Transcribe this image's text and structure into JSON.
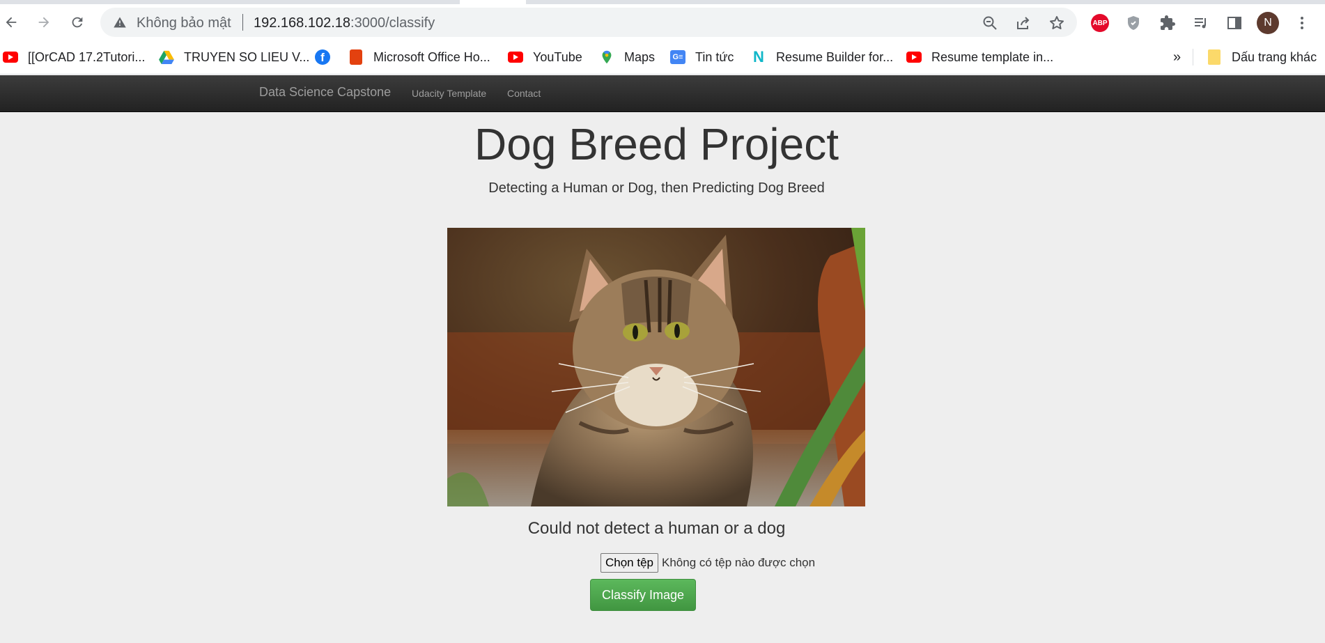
{
  "browser": {
    "security_label": "Không bảo mật",
    "url_host": "192.168.102.18",
    "url_rest": ":3000/classify",
    "profile_initial": "N",
    "extension_abp": "ABP",
    "bookmarks": [
      {
        "label": "[[OrCAD 17.2Tutori...",
        "icon": "youtube-icon"
      },
      {
        "label": "TRUYEN SO LIEU V...",
        "icon": "google-drive-icon"
      },
      {
        "label": "",
        "icon": "facebook-icon"
      },
      {
        "label": "Microsoft Office Ho...",
        "icon": "office-icon"
      },
      {
        "label": "YouTube",
        "icon": "youtube-icon"
      },
      {
        "label": "Maps",
        "icon": "maps-icon"
      },
      {
        "label": "Tin tức",
        "icon": "google-news-icon"
      },
      {
        "label": "Resume Builder for...",
        "icon": "resume-builder-icon"
      },
      {
        "label": "Resume template in...",
        "icon": "youtube-icon"
      }
    ],
    "bookmarks_overflow": "»",
    "other_bookmarks": "Dấu trang khác"
  },
  "navbar": {
    "brand": "Data Science Capstone",
    "links": [
      "Udacity Template",
      "Contact"
    ]
  },
  "main": {
    "title": "Dog Breed Project",
    "subtitle": "Detecting a Human or Dog, then Predicting Dog Breed",
    "image_subject": "tabby cat photo",
    "result": "Could not detect a human or a dog",
    "file_button": "Chọn tệp",
    "file_status": "Không có tệp nào được chọn",
    "classify_button": "Classify Image"
  },
  "colors": {
    "navbar": "#222222",
    "button_green": "#5cb85c",
    "page_bg": "#eeeeee"
  }
}
